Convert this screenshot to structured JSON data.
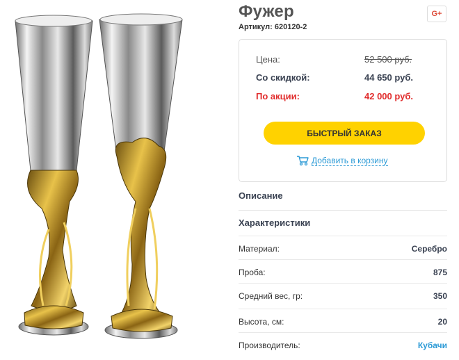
{
  "product": {
    "title": "Фужер",
    "article": "Артикул: 620120-2",
    "share_label": "G+",
    "image_icon": "champagne-glasses-image"
  },
  "price": {
    "regular_label": "Цена:",
    "regular_value": "52 500 руб.",
    "discount_label": "Со скидкой:",
    "discount_value": "44 650 руб.",
    "promo_label": "По акции:",
    "promo_value": "42 000 руб.",
    "quick_order_label": "БЫСТРЫЙ ЗАКАЗ",
    "add_to_cart_label": "Добавить в корзину"
  },
  "sections": {
    "description": "Описание",
    "characteristics": "Характеристики"
  },
  "specs": [
    {
      "label": "Материал:",
      "value": "Серебро"
    },
    {
      "label": "Проба:",
      "value": "875"
    },
    {
      "label": "Средний вес, гр:",
      "value": "350"
    },
    {
      "label": "Высота, см:",
      "value": "20"
    },
    {
      "label": "Производитель:",
      "value": "Кубачи"
    }
  ],
  "colors": {
    "accent_yellow": "#ffd200",
    "promo_red": "#e12d2d",
    "link_blue": "#2b9ad6"
  }
}
